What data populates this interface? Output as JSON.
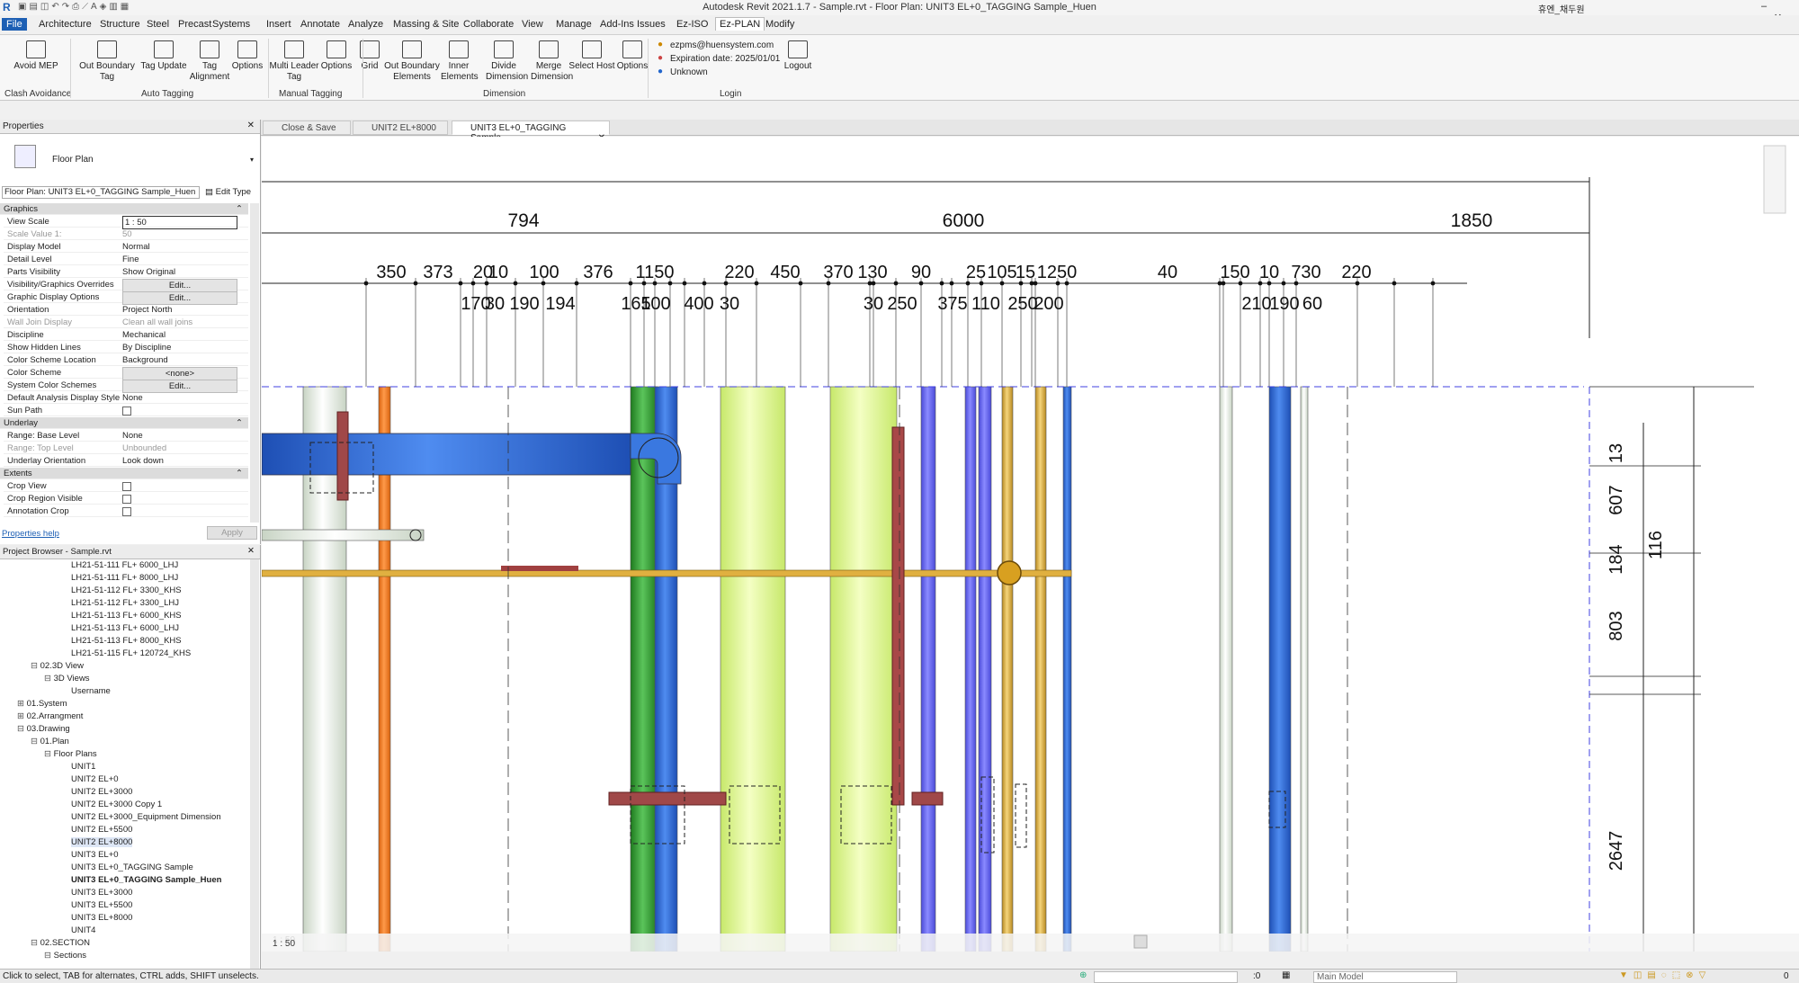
{
  "titlebar": {
    "title": "Autodesk Revit 2021.1.7 - Sample.rvt - Floor Plan: UNIT3 EL+0_TAGGING Sample_Huen",
    "user": "휴엔_채두원"
  },
  "menu": [
    "File",
    "Architecture",
    "Structure",
    "Steel",
    "Precast",
    "Systems",
    "Insert",
    "Annotate",
    "Analyze",
    "Massing & Site",
    "Collaborate",
    "View",
    "Manage",
    "Add-Ins",
    "Issues",
    "Ez-ISO",
    "Ez-PLAN",
    "Modify"
  ],
  "ribbon": {
    "buttons": [
      {
        "label": "Avoid MEP",
        "icon": "avoid-mep-icon"
      },
      {
        "label": "Out Boundary Tag",
        "icon": "out-boundary-tag-icon"
      },
      {
        "label": "Tag Update",
        "icon": "tag-update-icon"
      },
      {
        "label": "Tag Alignment",
        "icon": "tag-alignment-icon"
      },
      {
        "label": "Options",
        "icon": "options-icon"
      },
      {
        "label": "Multi Leader Tag",
        "icon": "multi-leader-tag-icon"
      },
      {
        "label": "Options",
        "icon": "options-icon"
      },
      {
        "label": "Grid",
        "icon": "grid-icon"
      },
      {
        "label": "Out Boundary Elements",
        "icon": "out-boundary-elements-icon"
      },
      {
        "label": "Inner Elements",
        "icon": "inner-elements-icon"
      },
      {
        "label": "Divide Dimension",
        "icon": "divide-dimension-icon"
      },
      {
        "label": "Merge Dimension",
        "icon": "merge-dimension-icon"
      },
      {
        "label": "Select Host",
        "icon": "select-host-icon"
      },
      {
        "label": "Options",
        "icon": "options-icon"
      },
      {
        "label": "Logout",
        "icon": "logout-icon"
      }
    ],
    "groups": [
      "Clash Avoidance",
      "Auto Tagging",
      "Manual Tagging",
      "Dimension",
      "Login"
    ],
    "login": {
      "email": "ezpms@huensystem.com",
      "expiry": "Expiration date: 2025/01/01",
      "status": "Unknown"
    }
  },
  "viewtabs": [
    "Close & Save",
    "UNIT2 EL+8000",
    "UNIT3 EL+0_TAGGING Sample_..."
  ],
  "properties": {
    "title": "Properties",
    "type": "Floor Plan",
    "selector": "Floor Plan: UNIT3 EL+0_TAGGING Sample_Huen",
    "edit_type": "Edit Type",
    "rows": [
      {
        "k": "Graphics",
        "sec": true
      },
      {
        "k": "View Scale",
        "v": "1 : 50"
      },
      {
        "k": "Scale Value    1:",
        "v": "50"
      },
      {
        "k": "Display Model",
        "v": "Normal"
      },
      {
        "k": "Detail Level",
        "v": "Fine"
      },
      {
        "k": "Parts Visibility",
        "v": "Show Original"
      },
      {
        "k": "Visibility/Graphics Overrides",
        "v": "Edit..."
      },
      {
        "k": "Graphic Display Options",
        "v": "Edit..."
      },
      {
        "k": "Orientation",
        "v": "Project North"
      },
      {
        "k": "Wall Join Display",
        "v": "Clean all wall joins"
      },
      {
        "k": "Discipline",
        "v": "Mechanical"
      },
      {
        "k": "Show Hidden Lines",
        "v": "By Discipline"
      },
      {
        "k": "Color Scheme Location",
        "v": "Background"
      },
      {
        "k": "Color Scheme",
        "v": "<none>"
      },
      {
        "k": "System Color Schemes",
        "v": "Edit..."
      },
      {
        "k": "Default Analysis Display Style",
        "v": "None"
      },
      {
        "k": "Sun Path",
        "v": ""
      },
      {
        "k": "Underlay",
        "sec": true
      },
      {
        "k": "Range: Base Level",
        "v": "None"
      },
      {
        "k": "Range: Top Level",
        "v": "Unbounded"
      },
      {
        "k": "Underlay Orientation",
        "v": "Look down"
      },
      {
        "k": "Extents",
        "sec": true
      },
      {
        "k": "Crop View",
        "v": ""
      },
      {
        "k": "Crop Region Visible",
        "v": ""
      },
      {
        "k": "Annotation Crop",
        "v": ""
      }
    ],
    "help": "Properties help",
    "apply": "Apply"
  },
  "browser": {
    "title": "Project Browser - Sample.rvt",
    "items": [
      {
        "t": "LH21-51-111 FL+ 6000_LHJ",
        "d": 5
      },
      {
        "t": "LH21-51-111 FL+ 8000_LHJ",
        "d": 5
      },
      {
        "t": "LH21-51-112 FL+ 3300_KHS",
        "d": 5
      },
      {
        "t": "LH21-51-112 FL+ 3300_LHJ",
        "d": 5
      },
      {
        "t": "LH21-51-113 FL+ 6000_KHS",
        "d": 5
      },
      {
        "t": "LH21-51-113 FL+ 6000_LHJ",
        "d": 5
      },
      {
        "t": "LH21-51-113 FL+ 8000_KHS",
        "d": 5
      },
      {
        "t": "LH21-51-115 FL+ 120724_KHS",
        "d": 5
      },
      {
        "t": "02.3D View",
        "d": 2,
        "e": "⊟"
      },
      {
        "t": "3D Views",
        "d": 3,
        "e": "⊟"
      },
      {
        "t": "Username",
        "d": 5
      },
      {
        "t": "01.System",
        "d": 1,
        "e": "⊞"
      },
      {
        "t": "02.Arrangment",
        "d": 1,
        "e": "⊞"
      },
      {
        "t": "03.Drawing",
        "d": 1,
        "e": "⊟"
      },
      {
        "t": "01.Plan",
        "d": 2,
        "e": "⊟"
      },
      {
        "t": "Floor Plans",
        "d": 3,
        "e": "⊟"
      },
      {
        "t": "UNIT1",
        "d": 5
      },
      {
        "t": "UNIT2 EL+0",
        "d": 5
      },
      {
        "t": "UNIT2 EL+3000",
        "d": 5
      },
      {
        "t": "UNIT2 EL+3000 Copy 1",
        "d": 5
      },
      {
        "t": "UNIT2 EL+3000_Equipment Dimension",
        "d": 5
      },
      {
        "t": "UNIT2 EL+5500",
        "d": 5
      },
      {
        "t": "UNIT2 EL+8000",
        "d": 5,
        "hl": true
      },
      {
        "t": "UNIT3 EL+0",
        "d": 5
      },
      {
        "t": "UNIT3 EL+0_TAGGING Sample",
        "d": 5
      },
      {
        "t": "UNIT3 EL+0_TAGGING Sample_Huen",
        "d": 5,
        "b": true
      },
      {
        "t": "UNIT3 EL+3000",
        "d": 5
      },
      {
        "t": "UNIT3 EL+5500",
        "d": 5
      },
      {
        "t": "UNIT3 EL+8000",
        "d": 5
      },
      {
        "t": "UNIT4",
        "d": 5
      },
      {
        "t": "02.SECTION",
        "d": 2,
        "e": "⊟"
      },
      {
        "t": "Sections",
        "d": 3,
        "e": "⊟"
      }
    ]
  },
  "drawing": {
    "top_dims": [
      "794",
      "6000",
      "1850"
    ],
    "row1": [
      "350",
      "373",
      "20",
      "10",
      "100",
      "376",
      "1150",
      "220",
      "450",
      "370",
      "130",
      "90",
      "25",
      "105",
      "15",
      "1250",
      "40",
      "150",
      "10",
      "730",
      "220"
    ],
    "row2": [
      "170",
      "30",
      "190",
      "194",
      "165",
      "100",
      "400",
      "30",
      "30",
      "250",
      "375",
      "110",
      "250",
      "200",
      "210",
      "190",
      "60"
    ],
    "right_dims": [
      "13",
      "607",
      "116",
      "184",
      "803",
      "2647"
    ],
    "scale": "1 : 50"
  },
  "status": {
    "hint": "Click to select, TAB for alternates, CTRL adds, SHIFT unselects.",
    "coord": ":0",
    "model": "Main Model",
    "zero": "0"
  }
}
